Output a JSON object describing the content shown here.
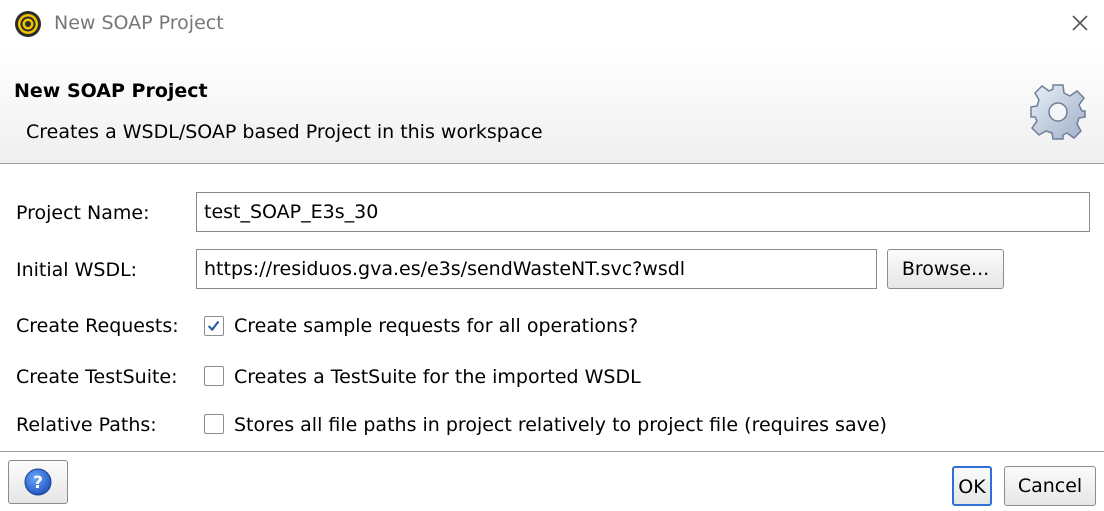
{
  "window": {
    "title": "New SOAP Project",
    "icon": "soapui-logo-icon",
    "close_icon": "close-icon"
  },
  "header": {
    "title": "New SOAP Project",
    "description": "Creates a WSDL/SOAP based Project in this workspace",
    "icon": "gear-icon"
  },
  "form": {
    "project_name": {
      "label": "Project Name:",
      "value": "test_SOAP_E3s_30"
    },
    "initial_wsdl": {
      "label": "Initial WSDL:",
      "value": "https://residuos.gva.es/e3s/sendWasteNT.svc?wsdl",
      "browse_label": "Browse..."
    },
    "create_requests": {
      "label": "Create Requests:",
      "checkbox_label": "Create sample requests for all operations?",
      "checked": true
    },
    "create_testsuite": {
      "label": "Create TestSuite:",
      "checkbox_label": "Creates a TestSuite for the imported WSDL",
      "checked": false
    },
    "relative_paths": {
      "label": "Relative Paths:",
      "checkbox_label": "Stores all file paths in project relatively to project file (requires save)",
      "checked": false
    }
  },
  "footer": {
    "help_icon": "help-icon",
    "ok_label": "OK",
    "cancel_label": "Cancel"
  },
  "colors": {
    "accent": "#2f6fd6",
    "check": "#2a5fa8"
  }
}
